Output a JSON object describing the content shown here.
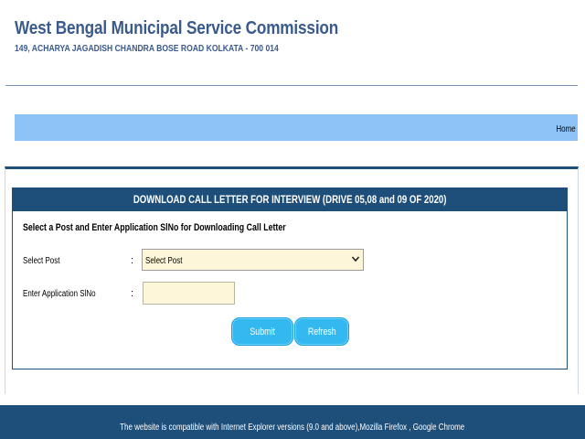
{
  "header": {
    "title": "West Bengal Municipal Service Commission",
    "address": "149, ACHARYA JAGADISH CHANDRA BOSE ROAD KOLKATA - 700 014"
  },
  "nav": {
    "home_label": "Home"
  },
  "form": {
    "heading": "DOWNLOAD CALL LETTER FOR INTERVIEW (DRIVE 05,08 and 09 OF 2020)",
    "instruction": "Select a Post and Enter Application SlNo for Downloading Call Letter",
    "post_label": "Select Post",
    "post_colon": ":",
    "post_value": "Select Post",
    "appno_label": "Enter Application SlNo",
    "appno_colon": ":",
    "appno_value": "",
    "submit_label": "Submit",
    "refresh_label": "Refresh"
  },
  "footer": {
    "text": "The website is compatible with Internet Explorer versions (9.0 and above),Mozilla Firefox , Google Chrome"
  },
  "colors": {
    "header_text": "#3a5a8c",
    "navbar": "#8ec3f7",
    "panel_header": "#1e4f7a",
    "field_bg": "#fdf6d8",
    "button": "#34b8f0"
  }
}
